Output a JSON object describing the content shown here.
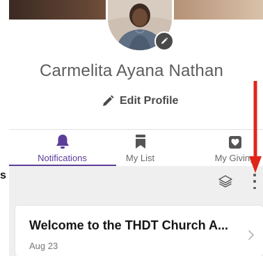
{
  "profile": {
    "name": "Carmelita Ayana Nathan",
    "edit_label": "Edit Profile"
  },
  "tabs": [
    {
      "label": "Notifications",
      "icon": "bell-icon",
      "active": true
    },
    {
      "label": "My List",
      "icon": "bookmark-icon",
      "active": false
    },
    {
      "label": "My Giving",
      "icon": "giving-icon",
      "active": false
    }
  ],
  "side_fragment": "s",
  "card": {
    "title": "Welcome to the THDT Church A...",
    "date": "Aug 23"
  },
  "colors": {
    "accent": "#5c3d9a",
    "annotation_arrow": "#e0261b",
    "feed_background": "#efefef"
  }
}
